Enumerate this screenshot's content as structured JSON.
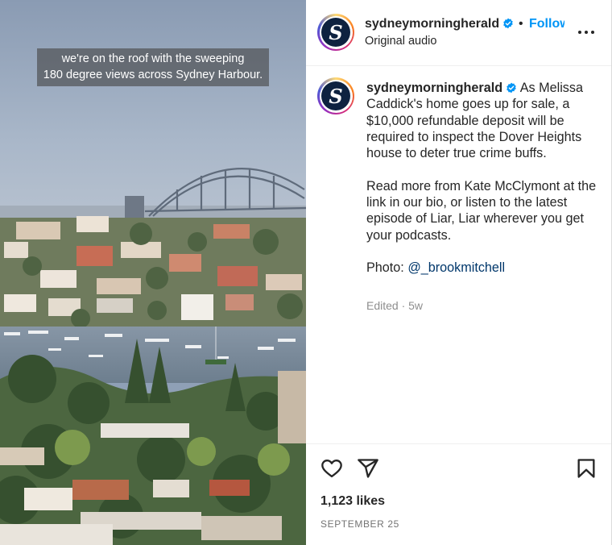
{
  "media": {
    "subtitle_line1": "we're on the roof with the sweeping",
    "subtitle_line2": "180 degree views across Sydney Harbour."
  },
  "header": {
    "username": "sydneymorningherald",
    "separator": "•",
    "follow_label": "Follow",
    "audio": "Original audio",
    "avatar_letter": "S"
  },
  "caption": {
    "username": "sydneymorningherald",
    "text1": "As Melissa Caddick's home goes up for sale, a $10,000 refundable deposit will be required to inspect the Dover Heights house to deter true crime buffs.",
    "text2": "Read more from Kate McClymont at the link in our bio, or listen to the latest episode of Liar, Liar wherever you get your podcasts.",
    "photo_prefix": "Photo: ",
    "photo_handle": "@_brookmitchell",
    "edited": "Edited · 5w"
  },
  "footer": {
    "likes": "1,123 likes",
    "date": "SEPTEMBER 25"
  },
  "colors": {
    "accent": "#0095f6",
    "link": "#00376b",
    "verified": "#0095f6",
    "brand_navy": "#0e2240"
  },
  "icons": {
    "verified": "verified-badge-icon",
    "more": "more-options-icon",
    "like": "heart-icon",
    "share": "paper-plane-icon",
    "save": "bookmark-icon"
  }
}
